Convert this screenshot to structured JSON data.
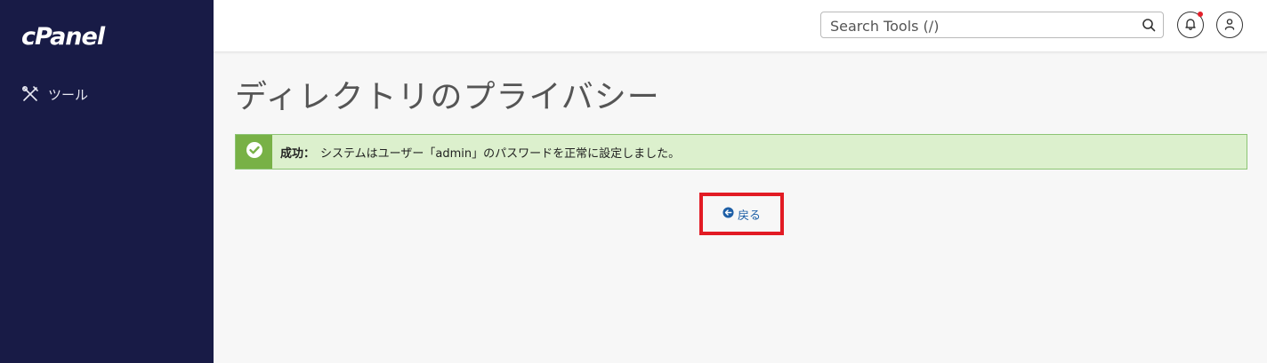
{
  "brand": {
    "logo": "cPanel"
  },
  "sidebar": {
    "items": [
      {
        "label": "ツール",
        "icon": "tools-icon"
      }
    ]
  },
  "header": {
    "search_placeholder": "Search Tools (/)",
    "search_icon": "search-icon",
    "notifications_icon": "bell-icon",
    "user_icon": "user-icon"
  },
  "main": {
    "title": "ディレクトリのプライバシー",
    "alert": {
      "label": "成功：",
      "message": "システムはユーザー「admin」のパスワードを正常に設定しました。",
      "icon": "check-circle-icon"
    },
    "back_button": {
      "label": "戻る",
      "icon": "arrow-left-circle-icon"
    }
  },
  "colors": {
    "sidebar_bg": "#181b46",
    "alert_bg": "#dcf0cd",
    "alert_icon_bg": "#78b146",
    "link": "#1e5fa6",
    "highlight": "#e21b24",
    "notification_dot": "#e3202b"
  }
}
